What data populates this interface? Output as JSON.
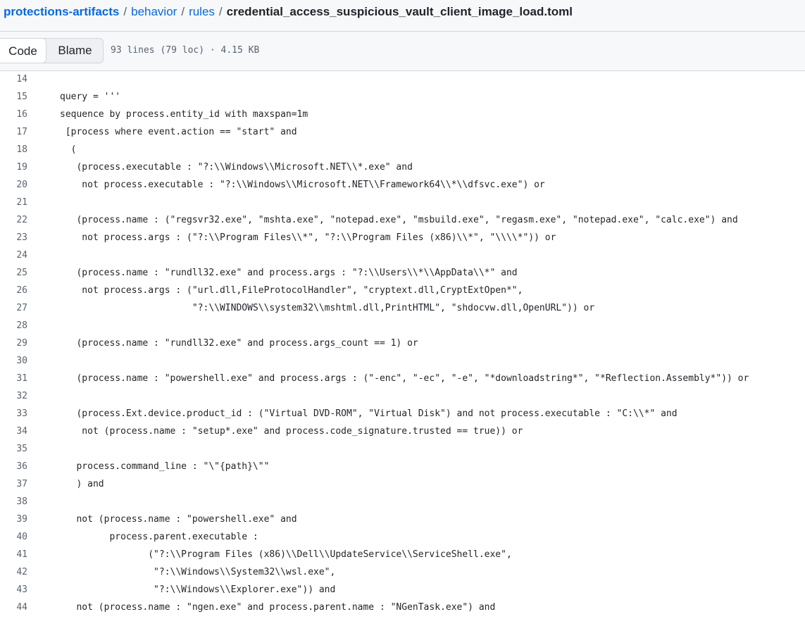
{
  "breadcrumb": {
    "repo": "protections-artifacts",
    "dirs": [
      "behavior",
      "rules"
    ],
    "separator": "/",
    "file": "credential_access_suspicious_vault_client_image_load.toml"
  },
  "toolbar": {
    "code_label": "Code",
    "blame_label": "Blame",
    "file_info": "93 lines (79 loc) · 4.15 KB"
  },
  "code": {
    "lines": [
      {
        "n": "14",
        "text": ""
      },
      {
        "n": "15",
        "text": "query = '''"
      },
      {
        "n": "16",
        "text": "sequence by process.entity_id with maxspan=1m"
      },
      {
        "n": "17",
        "text": " [process where event.action == \"start\" and"
      },
      {
        "n": "18",
        "text": "  ("
      },
      {
        "n": "19",
        "text": "   (process.executable : \"?:\\\\Windows\\\\Microsoft.NET\\\\*.exe\" and"
      },
      {
        "n": "20",
        "text": "    not process.executable : \"?:\\\\Windows\\\\Microsoft.NET\\\\Framework64\\\\*\\\\dfsvc.exe\") or"
      },
      {
        "n": "21",
        "text": ""
      },
      {
        "n": "22",
        "text": "   (process.name : (\"regsvr32.exe\", \"mshta.exe\", \"notepad.exe\", \"msbuild.exe\", \"regasm.exe\", \"notepad.exe\", \"calc.exe\") and"
      },
      {
        "n": "23",
        "text": "    not process.args : (\"?:\\\\Program Files\\\\*\", \"?:\\\\Program Files (x86)\\\\*\", \"\\\\\\\\*\")) or"
      },
      {
        "n": "24",
        "text": ""
      },
      {
        "n": "25",
        "text": "   (process.name : \"rundll32.exe\" and process.args : \"?:\\\\Users\\\\*\\\\AppData\\\\*\" and"
      },
      {
        "n": "26",
        "text": "    not process.args : (\"url.dll,FileProtocolHandler\", \"cryptext.dll,CryptExtOpen*\","
      },
      {
        "n": "27",
        "text": "                        \"?:\\\\WINDOWS\\\\system32\\\\mshtml.dll,PrintHTML\", \"shdocvw.dll,OpenURL\")) or"
      },
      {
        "n": "28",
        "text": ""
      },
      {
        "n": "29",
        "text": "   (process.name : \"rundll32.exe\" and process.args_count == 1) or"
      },
      {
        "n": "30",
        "text": ""
      },
      {
        "n": "31",
        "text": "   (process.name : \"powershell.exe\" and process.args : (\"-enc\", \"-ec\", \"-e\", \"*downloadstring*\", \"*Reflection.Assembly*\")) or"
      },
      {
        "n": "32",
        "text": ""
      },
      {
        "n": "33",
        "text": "   (process.Ext.device.product_id : (\"Virtual DVD-ROM\", \"Virtual Disk\") and not process.executable : \"C:\\\\*\" and"
      },
      {
        "n": "34",
        "text": "    not (process.name : \"setup*.exe\" and process.code_signature.trusted == true)) or"
      },
      {
        "n": "35",
        "text": ""
      },
      {
        "n": "36",
        "text": "   process.command_line : \"\\\"{path}\\\"\""
      },
      {
        "n": "37",
        "text": "   ) and"
      },
      {
        "n": "38",
        "text": ""
      },
      {
        "n": "39",
        "text": "   not (process.name : \"powershell.exe\" and"
      },
      {
        "n": "40",
        "text": "         process.parent.executable :"
      },
      {
        "n": "41",
        "text": "                (\"?:\\\\Program Files (x86)\\\\Dell\\\\UpdateService\\\\ServiceShell.exe\","
      },
      {
        "n": "42",
        "text": "                 \"?:\\\\Windows\\\\System32\\\\wsl.exe\","
      },
      {
        "n": "43",
        "text": "                 \"?:\\\\Windows\\\\Explorer.exe\")) and"
      },
      {
        "n": "44",
        "text": "   not (process.name : \"ngen.exe\" and process.parent.name : \"NGenTask.exe\") and"
      }
    ]
  }
}
